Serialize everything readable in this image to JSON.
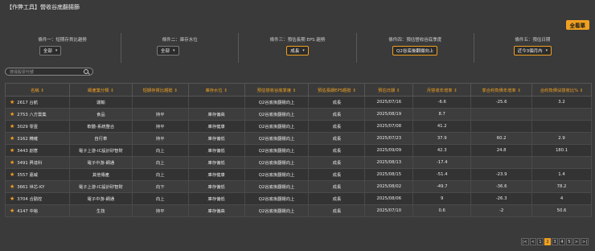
{
  "title": "【作弊工具】營收谷底翻揚篩",
  "primary_button": "全看單",
  "filters": [
    {
      "label": "條件一：短期存貨比趨勢",
      "value": "全部"
    },
    {
      "label": "條件二：庫存水位",
      "value": "全部"
    },
    {
      "label": "條件三：預估長期 EPS 趨勢",
      "value": "成長"
    },
    {
      "label": "條件四：預估營收谷底季度",
      "value": "Q2谷底後翻揚向上"
    },
    {
      "label": "條件五：預估日期",
      "value": "近今3個月內"
    }
  ],
  "search": {
    "placeholder": "搜尋股票代號"
  },
  "table": {
    "headers": [
      "名稱 ⇕",
      "細產業分類 ⇕",
      "短期存貨比趨勢 ⇕",
      "庫存水位 ⇕",
      "預估營收谷底季度 ⇕",
      "預估長期EPS趨勢 ⇕",
      "預估日期 ⇕",
      "月營收年增率 ⇕",
      "季合約負債年增率 ⇕",
      "合約負債佔營收比% ⇕"
    ],
    "rows": [
      [
        "2617 台航",
        "運輸",
        "",
        "",
        "Q2谷底後翻揚向上",
        "成長",
        "2025/07/16",
        "-6.6",
        "-25.6",
        "3.2"
      ],
      [
        "2753 八方雲集",
        "食品",
        "持平",
        "庫存偏高",
        "Q2谷底後翻揚向上",
        "成長",
        "2025/08/19",
        "8.7",
        "",
        ""
      ],
      [
        "3029 零壹",
        "軟體-系統整合",
        "持平",
        "庫存健康",
        "Q2谷底後翻揚向上",
        "成長",
        "2025/07/08",
        "41.2",
        "",
        ""
      ],
      [
        "3162 精確",
        "自行車",
        "持平",
        "庫存偏低",
        "Q2谷底後翻揚向上",
        "成長",
        "2025/07/23",
        "37.9",
        "60.2",
        "2.9"
      ],
      [
        "3443 創意",
        "電子上游-IC設計矽智財",
        "向上",
        "庫存偏低",
        "Q2谷底後翻揚向上",
        "成長",
        "2025/09/09",
        "42.3",
        "24.8",
        "180.1"
      ],
      [
        "3491 昇達科",
        "電子中游-網通",
        "向上",
        "庫存偏低",
        "Q2谷底後翻揚向上",
        "成長",
        "2025/08/13",
        "-17.4",
        "",
        ""
      ],
      [
        "3557 嘉威",
        "其他傳產",
        "向上",
        "庫存健康",
        "Q2谷底後翻揚向上",
        "成長",
        "2025/08/15",
        "-51.4",
        "-23.9",
        "1.4"
      ],
      [
        "3661 世芯-KY",
        "電子上游-IC設計矽智財",
        "向下",
        "庫存偏低",
        "Q2谷底後翻揚向上",
        "成長",
        "2025/08/02",
        "-49.7",
        "-36.6",
        "78.2"
      ],
      [
        "3704 合勤控",
        "電子中游-網通",
        "向上",
        "庫存偏低",
        "Q2谷底後翻揚向上",
        "成長",
        "2025/08/06",
        "9",
        "-26.3",
        "4"
      ],
      [
        "4147 中裕",
        "生技",
        "持平",
        "庫存偏高",
        "Q2谷底後翻揚向上",
        "成長",
        "2025/07/10",
        "0.6",
        "-2",
        "50.6"
      ]
    ]
  },
  "pager": [
    "|<",
    "<",
    "1",
    "2",
    "3",
    "4",
    "5",
    ">",
    ">|"
  ],
  "pager_current": "2"
}
